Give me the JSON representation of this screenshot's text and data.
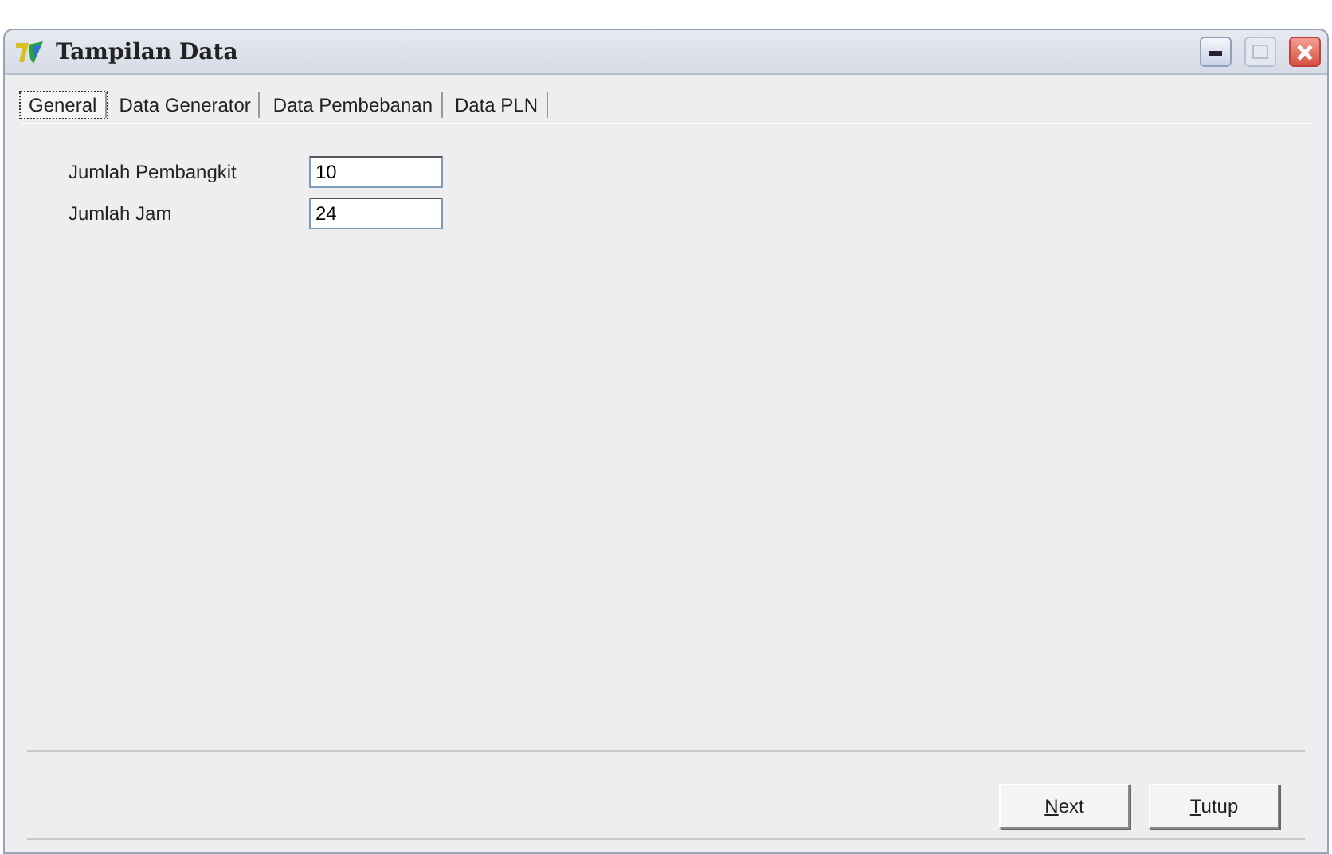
{
  "window": {
    "title": "Tampilan Data",
    "controls": {
      "maximize_disabled": true
    }
  },
  "tabs": [
    {
      "label": "General",
      "selected": true
    },
    {
      "label": "Data Generator",
      "selected": false
    },
    {
      "label": "Data Pembebanan",
      "selected": false
    },
    {
      "label": "Data PLN",
      "selected": false
    }
  ],
  "fields": [
    {
      "label": "Jumlah Pembangkit",
      "value": "10"
    },
    {
      "label": "Jumlah Jam",
      "value": "24"
    }
  ],
  "buttons": [
    {
      "label": "Next"
    },
    {
      "label": "Tutup"
    }
  ]
}
